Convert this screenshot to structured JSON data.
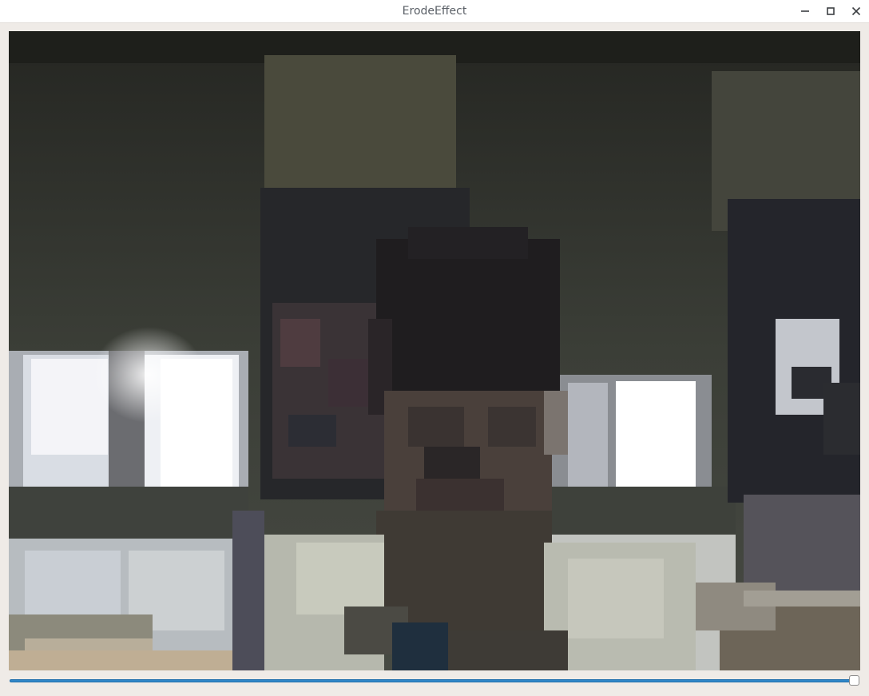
{
  "window": {
    "title": "ErodeEffect",
    "controls": {
      "minimize_icon": "minimize-icon",
      "maximize_icon": "maximize-icon",
      "close_icon": "close-icon"
    }
  },
  "video": {
    "description_icon": "camera-feed"
  },
  "slider": {
    "value_fraction": 1.0
  },
  "colors": {
    "titlebar": "#ffffff",
    "window_bg": "#efebe7",
    "slider_accent": "#2f86c7"
  }
}
